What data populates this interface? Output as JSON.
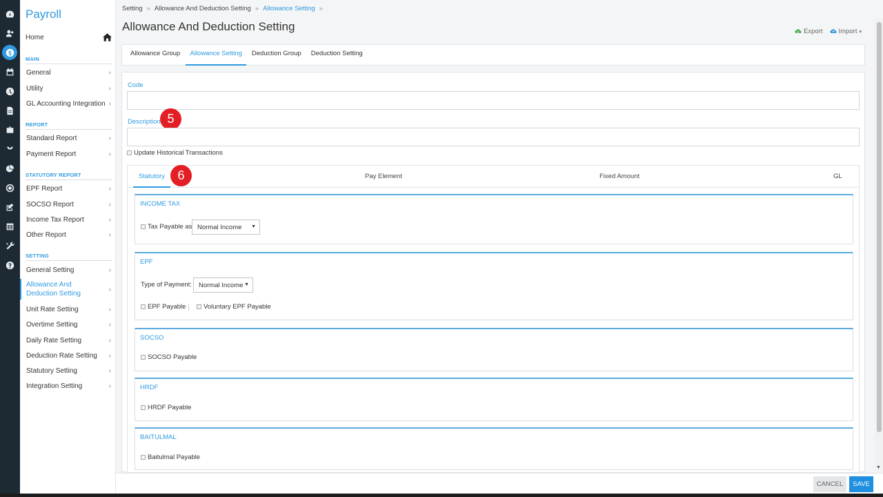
{
  "app": {
    "title": "Payroll"
  },
  "colors": {
    "accent": "#2f9ae0",
    "rail_bg": "#1e2a33",
    "badge": "#e31e24",
    "save_btn": "#1f8fe0"
  },
  "rail_icons": [
    "dashboard-icon",
    "people-icon",
    "payroll-dollar-icon",
    "calendar-icon",
    "clock-icon",
    "document-icon",
    "briefcase-icon",
    "plant-icon",
    "pie-chart-icon",
    "target-icon",
    "edit-icon",
    "table-icon",
    "tools-icon",
    "help-icon"
  ],
  "sidebar": {
    "home": "Home",
    "sections": [
      {
        "label": "MAIN",
        "items": [
          "General",
          "Utility",
          "GL Accounting Integration"
        ]
      },
      {
        "label": "REPORT",
        "items": [
          "Standard Report",
          "Payment Report"
        ]
      },
      {
        "label": "STATUTORY REPORT",
        "items": [
          "EPF Report",
          "SOCSO Report",
          "Income Tax Report",
          "Other Report"
        ]
      },
      {
        "label": "SETTING",
        "items": [
          "General Setting",
          "Allowance And Deduction Setting",
          "Unit Rate Setting",
          "Overtime Setting",
          "Daily Rate Setting",
          "Deduction Rate Setting",
          "Statutory Setting",
          "Integration Setting"
        ]
      }
    ],
    "active_item": "Allowance And Deduction Setting"
  },
  "breadcrumb": [
    "Setting",
    "Allowance And Deduction Setting",
    "Allowance Setting"
  ],
  "page": {
    "title": "Allowance And Deduction Setting"
  },
  "actions": {
    "export": "Export",
    "import": "Import"
  },
  "tabs": [
    "Allowance Group",
    "Allowance Setting",
    "Deduction Group",
    "Deduction Setting"
  ],
  "active_tab": "Allowance Setting",
  "form": {
    "code_label": "Code",
    "code_value": "",
    "description_label": "Description",
    "description_value": "",
    "update_historical": "Update Historical Transactions"
  },
  "badges": {
    "b5": "5",
    "b6": "6"
  },
  "sub_tabs": [
    "Statutory",
    "Pay Element",
    "Fixed Amount",
    "GL"
  ],
  "active_sub_tab": "Statutory",
  "statutory": {
    "income_tax": {
      "title": "INCOME TAX",
      "checkbox": "Tax Payable as",
      "select": "Normal Income"
    },
    "epf": {
      "title": "EPF",
      "type_label": "Type of Payment:",
      "select": "Normal Income",
      "checkbox1": "EPF Payable",
      "checkbox2": "Voluntary EPF Payable"
    },
    "socso": {
      "title": "SOCSO",
      "checkbox": "SOCSO Payable"
    },
    "hrdf": {
      "title": "HRDF",
      "checkbox": "HRDF Payable"
    },
    "baitulmal": {
      "title": "BAITULMAL",
      "checkbox": "Baitulmal Payable"
    }
  },
  "footer": {
    "cancel": "CANCEL",
    "save": "SAVE"
  }
}
